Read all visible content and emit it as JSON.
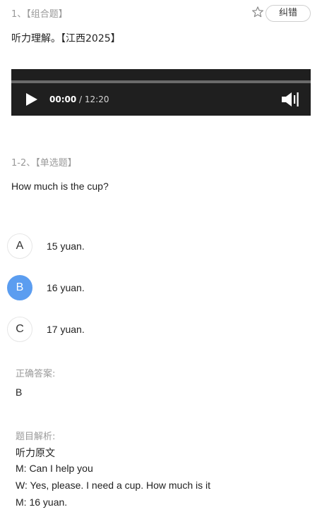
{
  "header": {
    "number": "1、【组合题】",
    "favorite_icon": "star-outline-icon",
    "correction_label": "纠错"
  },
  "stem": "听力理解。【江西2025】",
  "player": {
    "current_time": "00:00",
    "total_time": "/ 12:20",
    "play_icon": "play-icon",
    "volume_icon": "volume-icon"
  },
  "sub_question": {
    "label": "1-2、【单选题】",
    "text": "How much is the cup?",
    "options": [
      {
        "letter": "A",
        "text": "15 yuan.",
        "selected": false
      },
      {
        "letter": "B",
        "text": "16 yuan.",
        "selected": true
      },
      {
        "letter": "C",
        "text": "17 yuan.",
        "selected": false
      }
    ]
  },
  "answer": {
    "label": "正确答案:",
    "value": "B"
  },
  "analysis": {
    "label": "题目解析:",
    "lines": [
      "听力原文",
      "M: Can I help you",
      "W: Yes, please. I need a cup. How much is it",
      "M: 16 yuan."
    ]
  },
  "colors": {
    "selected_option": "#5b9df0",
    "muted_text": "#9a9a9a",
    "player_bg": "#1f1f1f"
  }
}
